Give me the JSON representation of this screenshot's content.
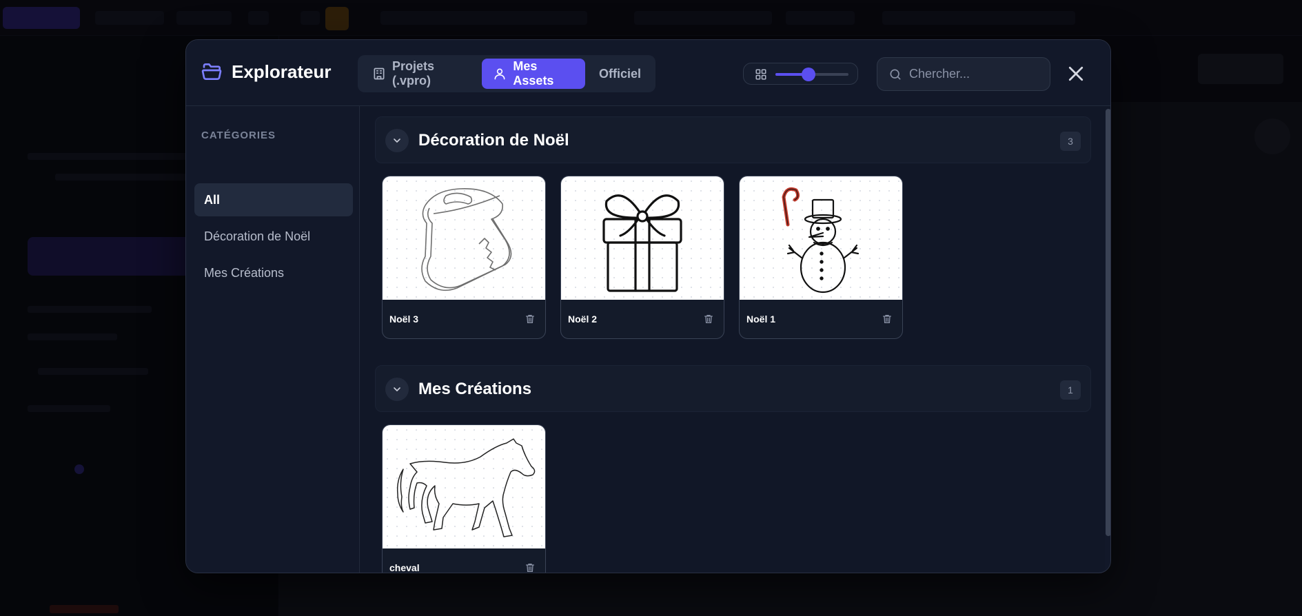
{
  "modal": {
    "title": "Explorateur",
    "icons": {
      "title": "folder-open-icon",
      "close": "close-icon",
      "search": "search-icon",
      "grid": "grid-icon"
    },
    "tabs": [
      {
        "label": "Projets (.vpro)",
        "icon": "building-icon",
        "active": false
      },
      {
        "label": "Mes Assets",
        "icon": "user-icon",
        "active": true
      },
      {
        "label": "Officiel",
        "icon": "",
        "active": false
      }
    ],
    "zoom": {
      "value": 0.45
    },
    "search": {
      "placeholder": "Chercher...",
      "value": ""
    }
  },
  "sidebar": {
    "heading": "CATÉGORIES",
    "items": [
      {
        "label": "All",
        "active": true
      },
      {
        "label": "Décoration de Noël",
        "active": false
      },
      {
        "label": "Mes Créations",
        "active": false
      }
    ]
  },
  "sections": [
    {
      "title": "Décoration de Noël",
      "count": "3",
      "items": [
        {
          "name": "Noël 3",
          "image": "christmas-stocking"
        },
        {
          "name": "Noël 2",
          "image": "gift-box"
        },
        {
          "name": "Noël 1",
          "image": "snowman-with-candy-cane"
        }
      ]
    },
    {
      "title": "Mes Créations",
      "count": "1",
      "items": [
        {
          "name": "cheval",
          "image": "horse-outline"
        }
      ]
    }
  ],
  "colors": {
    "accent": "#5b4ff0",
    "modal_bg": "#111727",
    "text": "#ffffff",
    "muted": "#7a8398"
  }
}
